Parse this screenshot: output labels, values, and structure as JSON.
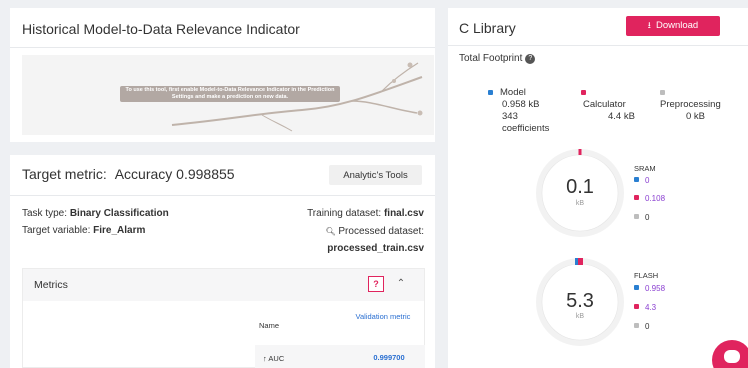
{
  "historical": {
    "title": "Historical Model-to-Data Relevance Indicator",
    "banner_note": "To use this tool, first enable Model-to-Data Relevance Indicator in the Prediction Settings and make a prediction on new data."
  },
  "target": {
    "title_prefix": "Target metric:",
    "title_value": "Accuracy 0.998855",
    "analytic_button": "Analytic's Tools",
    "task_label": "Task type:",
    "task_value": "Binary Classification",
    "target_var_label": "Target variable:",
    "target_var_value": "Fire_Alarm",
    "training_label": "Training dataset:",
    "training_value": "final.csv",
    "processed_label": "Processed dataset:",
    "processed_value": "processed_train.csv",
    "metrics": {
      "header": "Metrics",
      "help_button": "?",
      "col_name": "Name",
      "col_validation": "Validation metric",
      "rows": [
        {
          "name": "↑ AUC",
          "value": "0.999700"
        }
      ]
    }
  },
  "clib": {
    "title": "C Library",
    "download_button": "Download",
    "total_footprint": "Total Footprint",
    "legend": {
      "model": {
        "label": "Model",
        "size": "0.958 kB",
        "coef_count": "343",
        "coef_label": "coefficients",
        "color": "#2a7fd1"
      },
      "calculator": {
        "label": "Calculator",
        "size": "4.4 kB",
        "color": "#e0245e"
      },
      "preprocessing": {
        "label": "Preprocessing",
        "size": "0 kB",
        "color": "#bdbdbd"
      }
    },
    "sram": {
      "value": "0.1",
      "unit": "kB",
      "label": "SRAM",
      "items": [
        "0",
        "0.108",
        "0"
      ]
    },
    "flash": {
      "value": "5.3",
      "unit": "kB",
      "label": "FLASH",
      "items": [
        "0.958",
        "4.3",
        "0"
      ]
    }
  }
}
